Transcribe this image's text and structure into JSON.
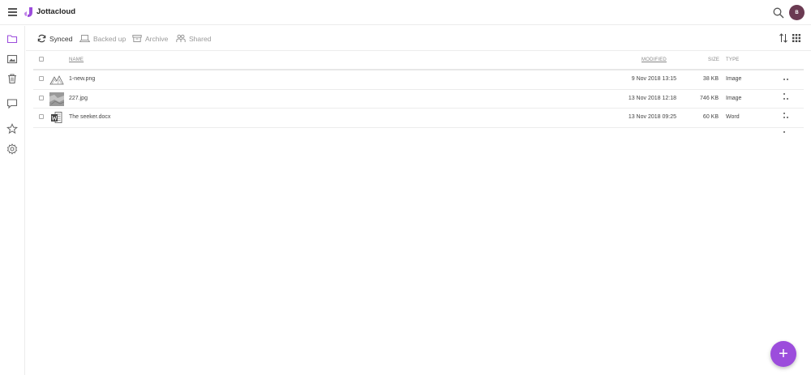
{
  "app": {
    "brand": "Jottacloud",
    "avatar_initial": "B",
    "accent": "#9c4ddc"
  },
  "tabs": [
    {
      "label": "Synced",
      "icon": "sync-icon",
      "active": true
    },
    {
      "label": "Backed up",
      "icon": "laptop-icon",
      "active": false
    },
    {
      "label": "Archive",
      "icon": "archive-icon",
      "active": false
    },
    {
      "label": "Shared",
      "icon": "people-icon",
      "active": false
    }
  ],
  "sidebar": [
    "folder-icon",
    "photo-icon",
    "trash-icon",
    "comment-icon",
    "star-icon",
    "gear-icon"
  ],
  "table": {
    "headers": {
      "name": "NAME",
      "modified": "MODIFIED",
      "size": "SIZE",
      "type": "TYPE"
    },
    "rows": [
      {
        "name": "1-new.png",
        "modified": "9 Nov 2018 13:15",
        "size": "38 KB",
        "type": "Image",
        "thumb": "png-thumb"
      },
      {
        "name": "227.jpg",
        "modified": "13 Nov 2018 12:18",
        "size": "746 KB",
        "type": "Image",
        "thumb": "jpg-thumb"
      },
      {
        "name": "The seeker.docx",
        "modified": "13 Nov 2018 09:25",
        "size": "60 KB",
        "type": "Word",
        "thumb": "word-icon"
      }
    ]
  },
  "fab": {
    "label": "+"
  }
}
